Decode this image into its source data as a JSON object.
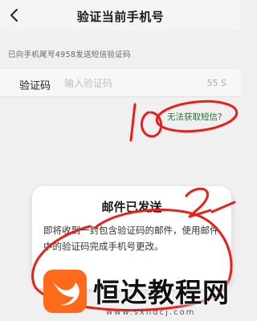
{
  "header": {
    "title": "验证当前手机号",
    "back_icon": "chevron-left-icon"
  },
  "form": {
    "hint": "已向手机尾号4958发送短信验证码",
    "code_label": "验证码",
    "code_placeholder": "输入验证码",
    "code_value": "",
    "countdown": "55 S",
    "cant_receive": "无法获取短信?"
  },
  "toast": {
    "title": "邮件已发送",
    "body": "即将收到一封包含验证码的邮件，使用邮件中的验证码完成手机号更改。"
  },
  "annotations": {
    "colors": {
      "marker": "#e8201a",
      "link": "#1a7a2a"
    }
  },
  "watermark": {
    "name": "恒达教程网",
    "url": "www.sxhdcj.com"
  }
}
